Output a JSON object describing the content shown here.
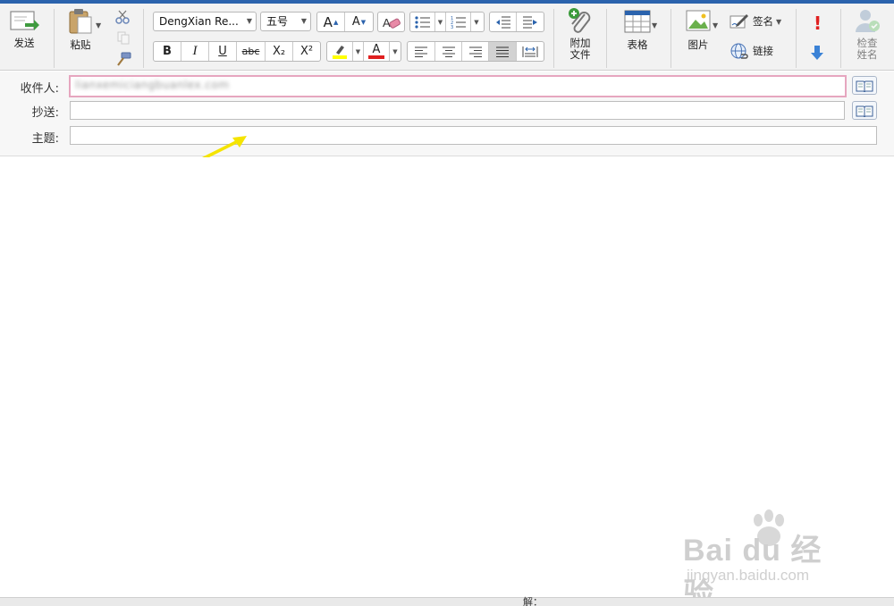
{
  "toolbar": {
    "send_label": "发送",
    "paste_label": "粘贴",
    "font_name": "DengXian Re...",
    "font_size": "五号",
    "attach_label_line1": "附加",
    "attach_label_line2": "文件",
    "table_label": "表格",
    "picture_label": "图片",
    "signature_label": "签名",
    "link_label": "链接",
    "check_names_line1": "检查",
    "check_names_line2": "姓名",
    "bold": "B",
    "italic": "I",
    "underline": "U",
    "strikethrough": "abc",
    "subscript": "X₂",
    "superscript": "X²",
    "grow_font": "A",
    "shrink_font": "A",
    "font_color_letter": "A"
  },
  "compose": {
    "to_label": "收件人:",
    "to_value": "lianxemiciangbuanlex.com",
    "cc_label": "抄送:",
    "cc_value": "",
    "subject_label": "主题:",
    "subject_value": ""
  },
  "footer": {
    "partial_text": "解："
  },
  "watermark": {
    "brand": "Bai du 经验",
    "url": "jingyan.baidu.com"
  },
  "colors": {
    "accent": "#2b63ad",
    "to_field_border": "#e6a6bf",
    "highlight_yellow": "#ffff00",
    "font_red": "#e02020",
    "arrow_yellow": "#f5e400"
  },
  "icons": [
    "send-icon",
    "paste-icon",
    "cut-icon",
    "copy-icon",
    "format-painter-icon",
    "clear-formatting-icon",
    "bullets-icon",
    "numbering-icon",
    "outdent-icon",
    "indent-icon",
    "attach-icon",
    "table-icon",
    "picture-icon",
    "signature-icon",
    "link-icon",
    "high-importance-icon",
    "low-importance-icon",
    "check-names-icon",
    "address-book-icon",
    "arrow-annotation"
  ]
}
